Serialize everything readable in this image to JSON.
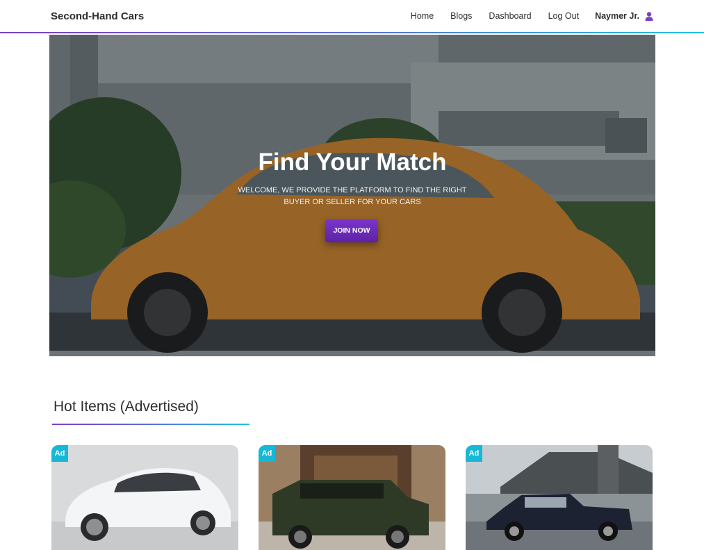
{
  "navbar": {
    "brand": "Second-Hand Cars",
    "links": [
      "Home",
      "Blogs",
      "Dashboard",
      "Log Out"
    ],
    "user_name": "Naymer Jr.",
    "user_icon": "user-icon"
  },
  "hero": {
    "title": "Find Your Match",
    "subtitle": "WELCOME, WE PROVIDE THE PLATFORM TO FIND THE RIGHT BUYER OR SELLER FOR YOUR CARS",
    "button_label": "JOIN NOW"
  },
  "section": {
    "title": "Hot Items (Advertised)"
  },
  "cards": [
    {
      "badge": "Ad"
    },
    {
      "badge": "Ad"
    },
    {
      "badge": "Ad"
    }
  ],
  "colors": {
    "accent_purple": "#7b3fc4",
    "accent_cyan": "#22c2e0",
    "badge": "#16b8d6"
  }
}
